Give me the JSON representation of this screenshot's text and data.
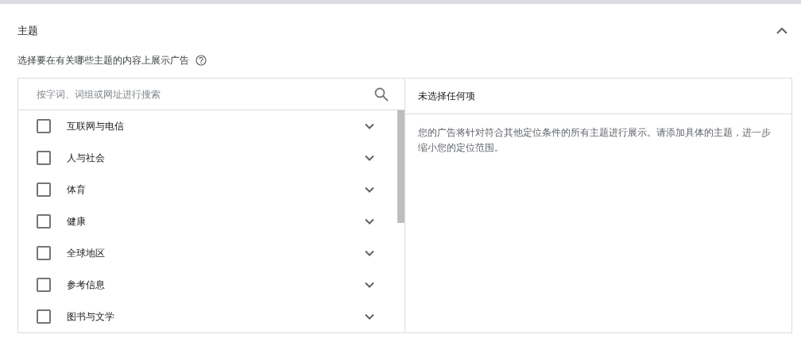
{
  "section": {
    "title": "主题",
    "expanded": true,
    "description": "选择要在有关哪些主题的内容上展示广告"
  },
  "search": {
    "placeholder": "按字词、词组或网址进行搜索"
  },
  "topics": [
    {
      "label": "互联网与电信",
      "checked": false
    },
    {
      "label": "人与社会",
      "checked": false
    },
    {
      "label": "体育",
      "checked": false
    },
    {
      "label": "健康",
      "checked": false
    },
    {
      "label": "全球地区",
      "checked": false
    },
    {
      "label": "参考信息",
      "checked": false
    },
    {
      "label": "图书与文学",
      "checked": false
    }
  ],
  "selection": {
    "title": "未选择任何项",
    "message": "您的广告将针对符合其他定位条件的所有主题进行展示。请添加具体的主题，进一步缩小您的定位范围。"
  }
}
